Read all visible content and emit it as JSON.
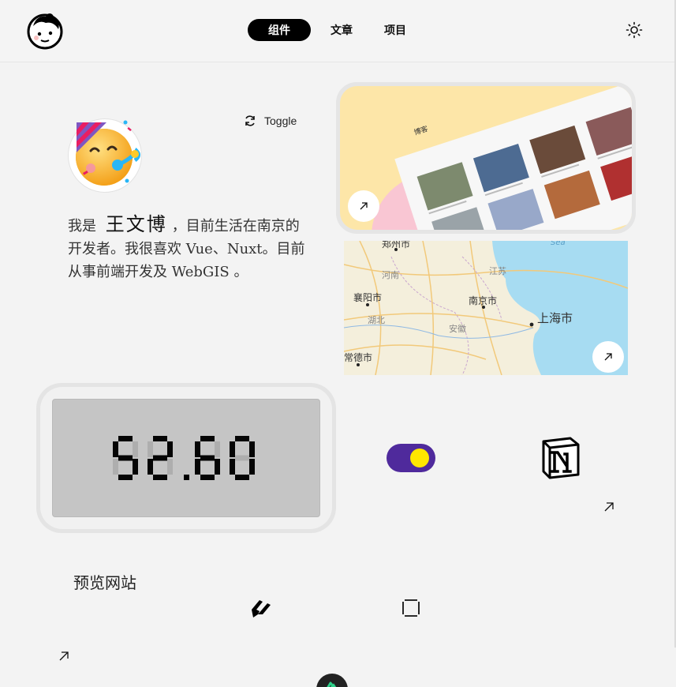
{
  "header": {
    "nav": [
      {
        "label": "组件",
        "active": true
      },
      {
        "label": "文章",
        "active": false
      },
      {
        "label": "项目",
        "active": false
      }
    ],
    "logo_icon": "avatar-face-icon",
    "theme_icon": "sun-icon"
  },
  "profile": {
    "avatar_icon": "party-face-emoji",
    "toggle_label": "Toggle",
    "toggle_icon": "refresh-icon",
    "bio_prefix": "我是",
    "name": "王文博",
    "bio_rest": "，目前生活在南京的开发者。我很喜欢 Vue、Nuxt。目前从事前端开发及 WebGIS 。"
  },
  "blog_card": {
    "app_label": "博客",
    "arrow_icon": "arrow-up-right-icon"
  },
  "map_card": {
    "labels": [
      "郑州市",
      "河南",
      "江苏",
      "襄阳市",
      "南京市",
      "湖北",
      "安徽",
      "上海市",
      "常德市",
      "Sea"
    ],
    "arrow_icon": "arrow-up-right-icon"
  },
  "clock": {
    "display": "52.60"
  },
  "toggle_switch": {
    "on": true,
    "track_color": "#4f2a9c",
    "knob_color": "#ffe600"
  },
  "notion": {
    "icon": "notion-icon",
    "arrow_icon": "arrow-up-right-icon"
  },
  "preview": {
    "label": "预览网站",
    "icons": [
      "slash-logo-icon",
      "frame-icon",
      "arrow-up-right-icon",
      "nuxt-icon"
    ]
  }
}
